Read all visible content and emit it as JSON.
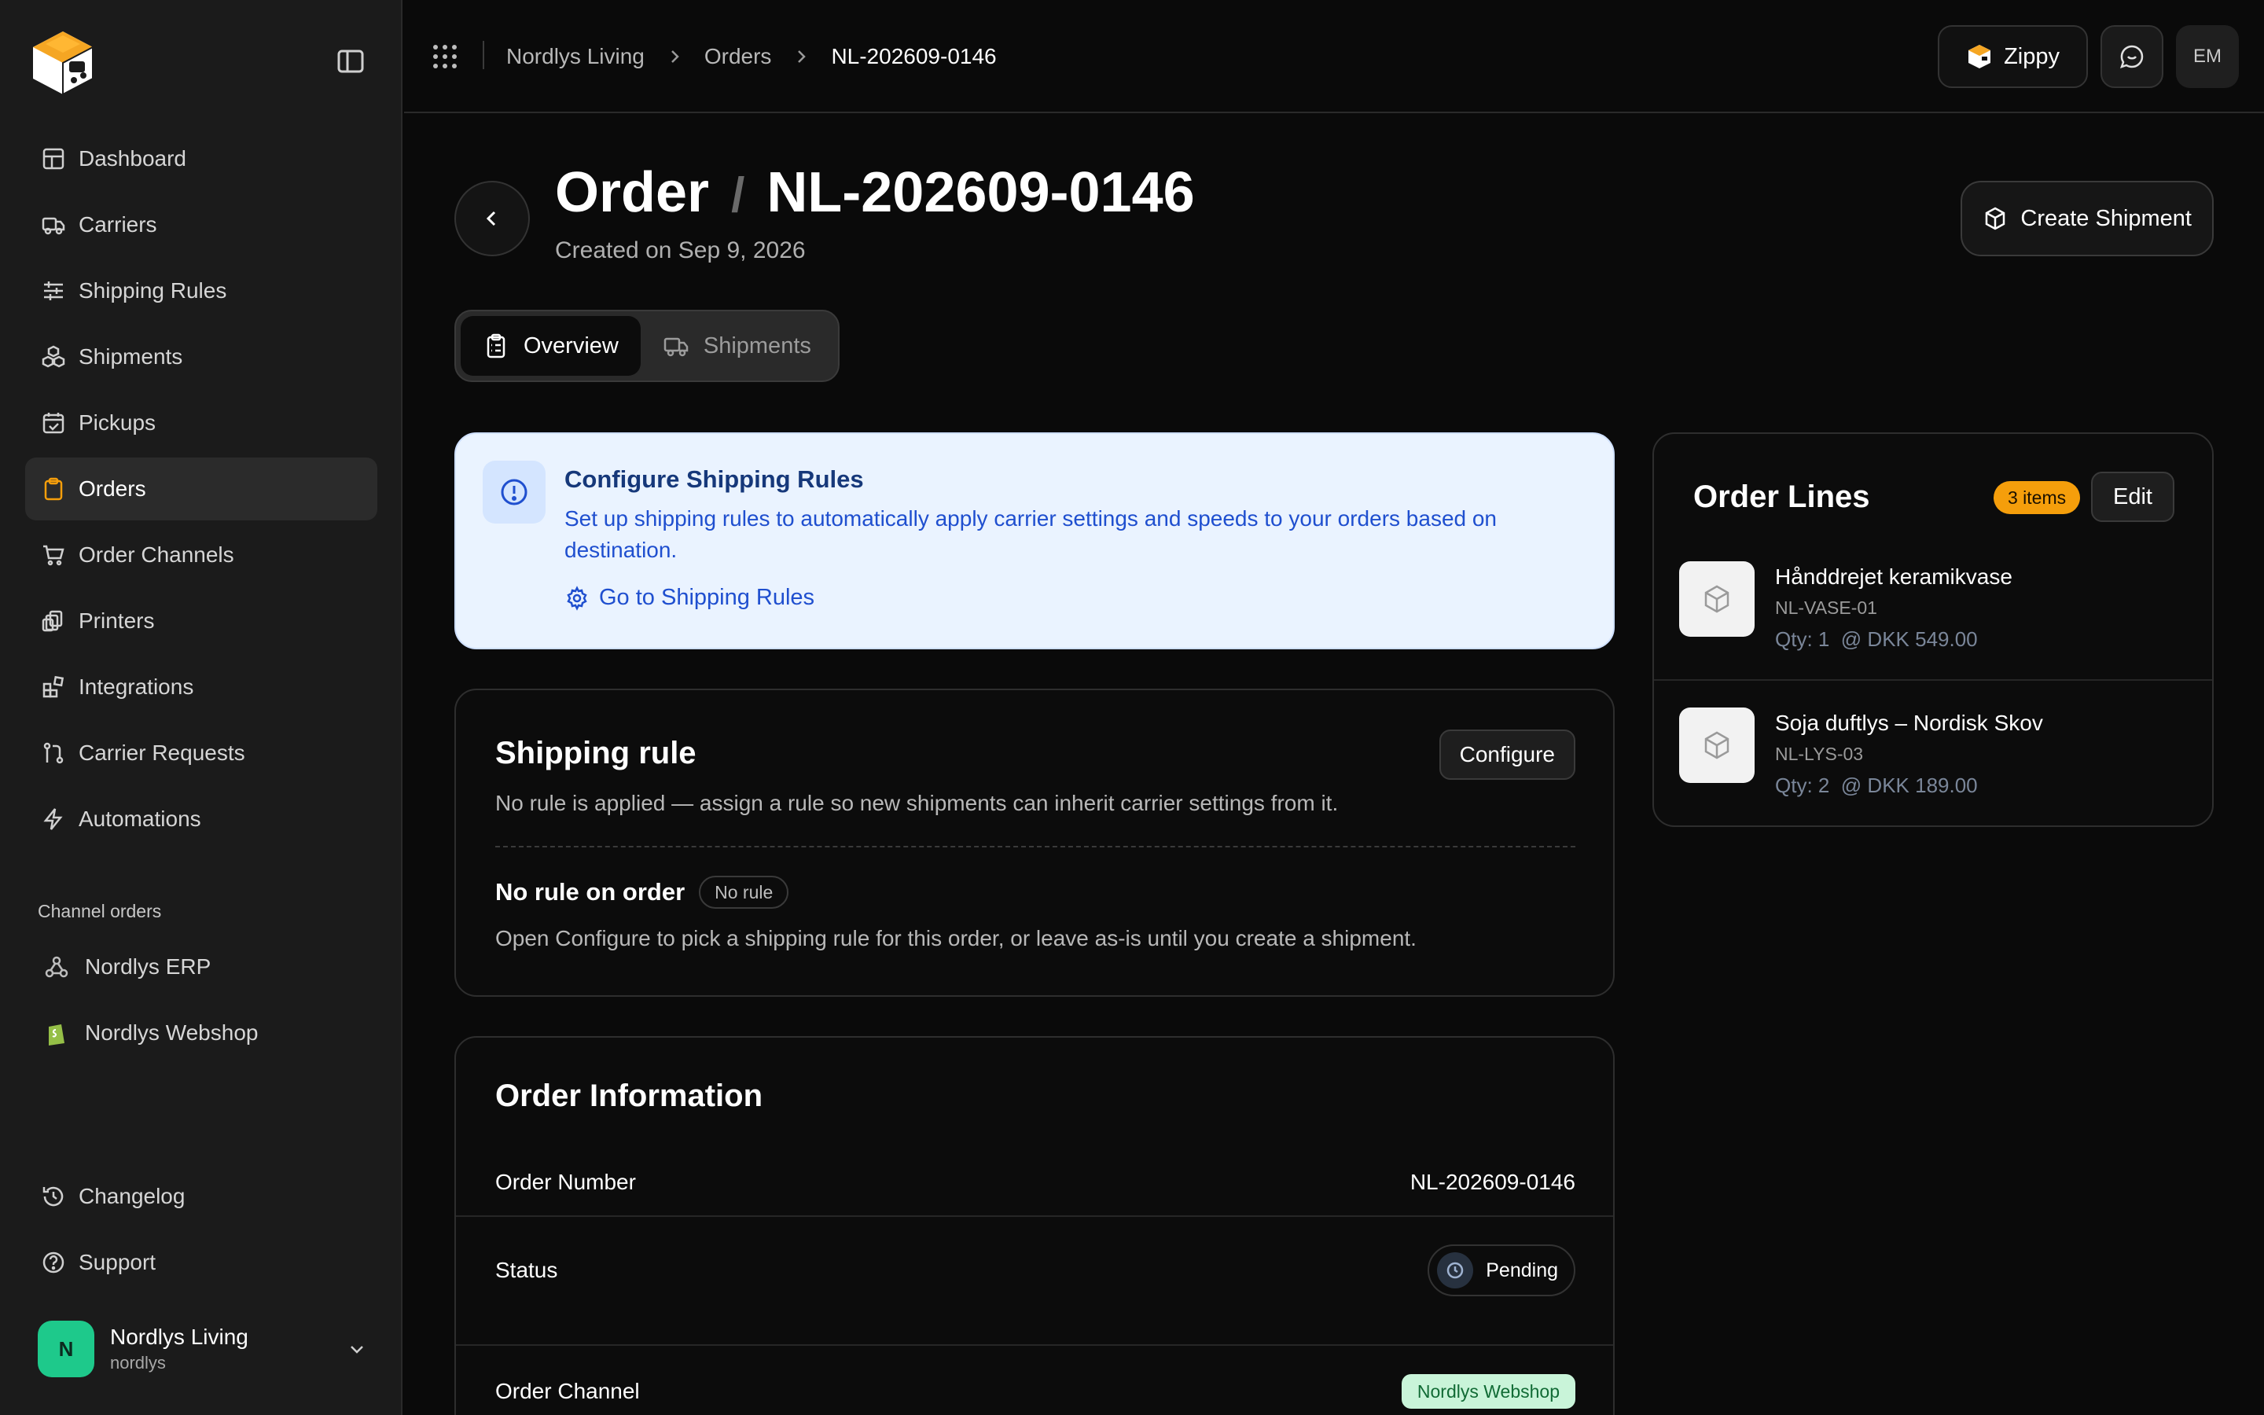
{
  "sidebar": {
    "nav": [
      {
        "label": "Dashboard"
      },
      {
        "label": "Carriers"
      },
      {
        "label": "Shipping Rules"
      },
      {
        "label": "Shipments"
      },
      {
        "label": "Pickups"
      },
      {
        "label": "Orders"
      },
      {
        "label": "Order Channels"
      },
      {
        "label": "Printers"
      },
      {
        "label": "Integrations"
      },
      {
        "label": "Carrier Requests"
      },
      {
        "label": "Automations"
      }
    ],
    "active_item": "Orders",
    "section_label": "Channel orders",
    "channels": [
      {
        "label": "Nordlys ERP"
      },
      {
        "label": "Nordlys Webshop"
      }
    ],
    "bottom": [
      {
        "label": "Changelog"
      },
      {
        "label": "Support"
      }
    ],
    "user": {
      "initial": "N",
      "name": "Nordlys Living",
      "handle": "nordlys"
    }
  },
  "topbar": {
    "breadcrumb": [
      "Nordlys Living",
      "Orders",
      "NL-202609-0146"
    ],
    "zippy_label": "Zippy",
    "user_initials": "EM"
  },
  "header": {
    "title_prefix": "Order",
    "title_separator": "/",
    "order_id": "NL-202609-0146",
    "created": "Created on Sep 9, 2026",
    "create_button": "Create Shipment"
  },
  "tabs": [
    {
      "label": "Overview",
      "active": true
    },
    {
      "label": "Shipments",
      "active": false
    }
  ],
  "banner": {
    "title": "Configure Shipping Rules",
    "text": "Set up shipping rules to automatically apply carrier settings and speeds to your orders based on destination.",
    "link": "Go to Shipping Rules"
  },
  "shipping_rule": {
    "title": "Shipping rule",
    "configure_button": "Configure",
    "description": "No rule is applied — assign a rule so new shipments can inherit carrier settings from it.",
    "subheading": "No rule on order",
    "pill": "No rule",
    "note": "Open Configure to pick a shipping rule for this order, or leave as-is until you create a shipment."
  },
  "order_info": {
    "title": "Order Information",
    "rows": [
      {
        "label": "Order Number",
        "value": "NL-202609-0146"
      },
      {
        "label": "Status",
        "value": "Pending"
      },
      {
        "label": "Order Channel",
        "value": "Nordlys Webshop"
      }
    ]
  },
  "order_lines": {
    "title": "Order Lines",
    "count_badge": "3 items",
    "edit_button": "Edit",
    "items": [
      {
        "name": "Hånddrejet keramikvase",
        "sku": "NL-VASE-01",
        "qty": "Qty: 1  @ DKK 549.00"
      },
      {
        "name": "Soja duftlys – Nordisk Skov",
        "sku": "NL-LYS-03",
        "qty": "Qty: 2  @ DKK 189.00"
      }
    ]
  },
  "colors": {
    "accent_orange": "#f59e0b",
    "success_green": "#1ec98b",
    "info_blue": "#1f4fcf",
    "info_bg": "#eaf3ff"
  }
}
